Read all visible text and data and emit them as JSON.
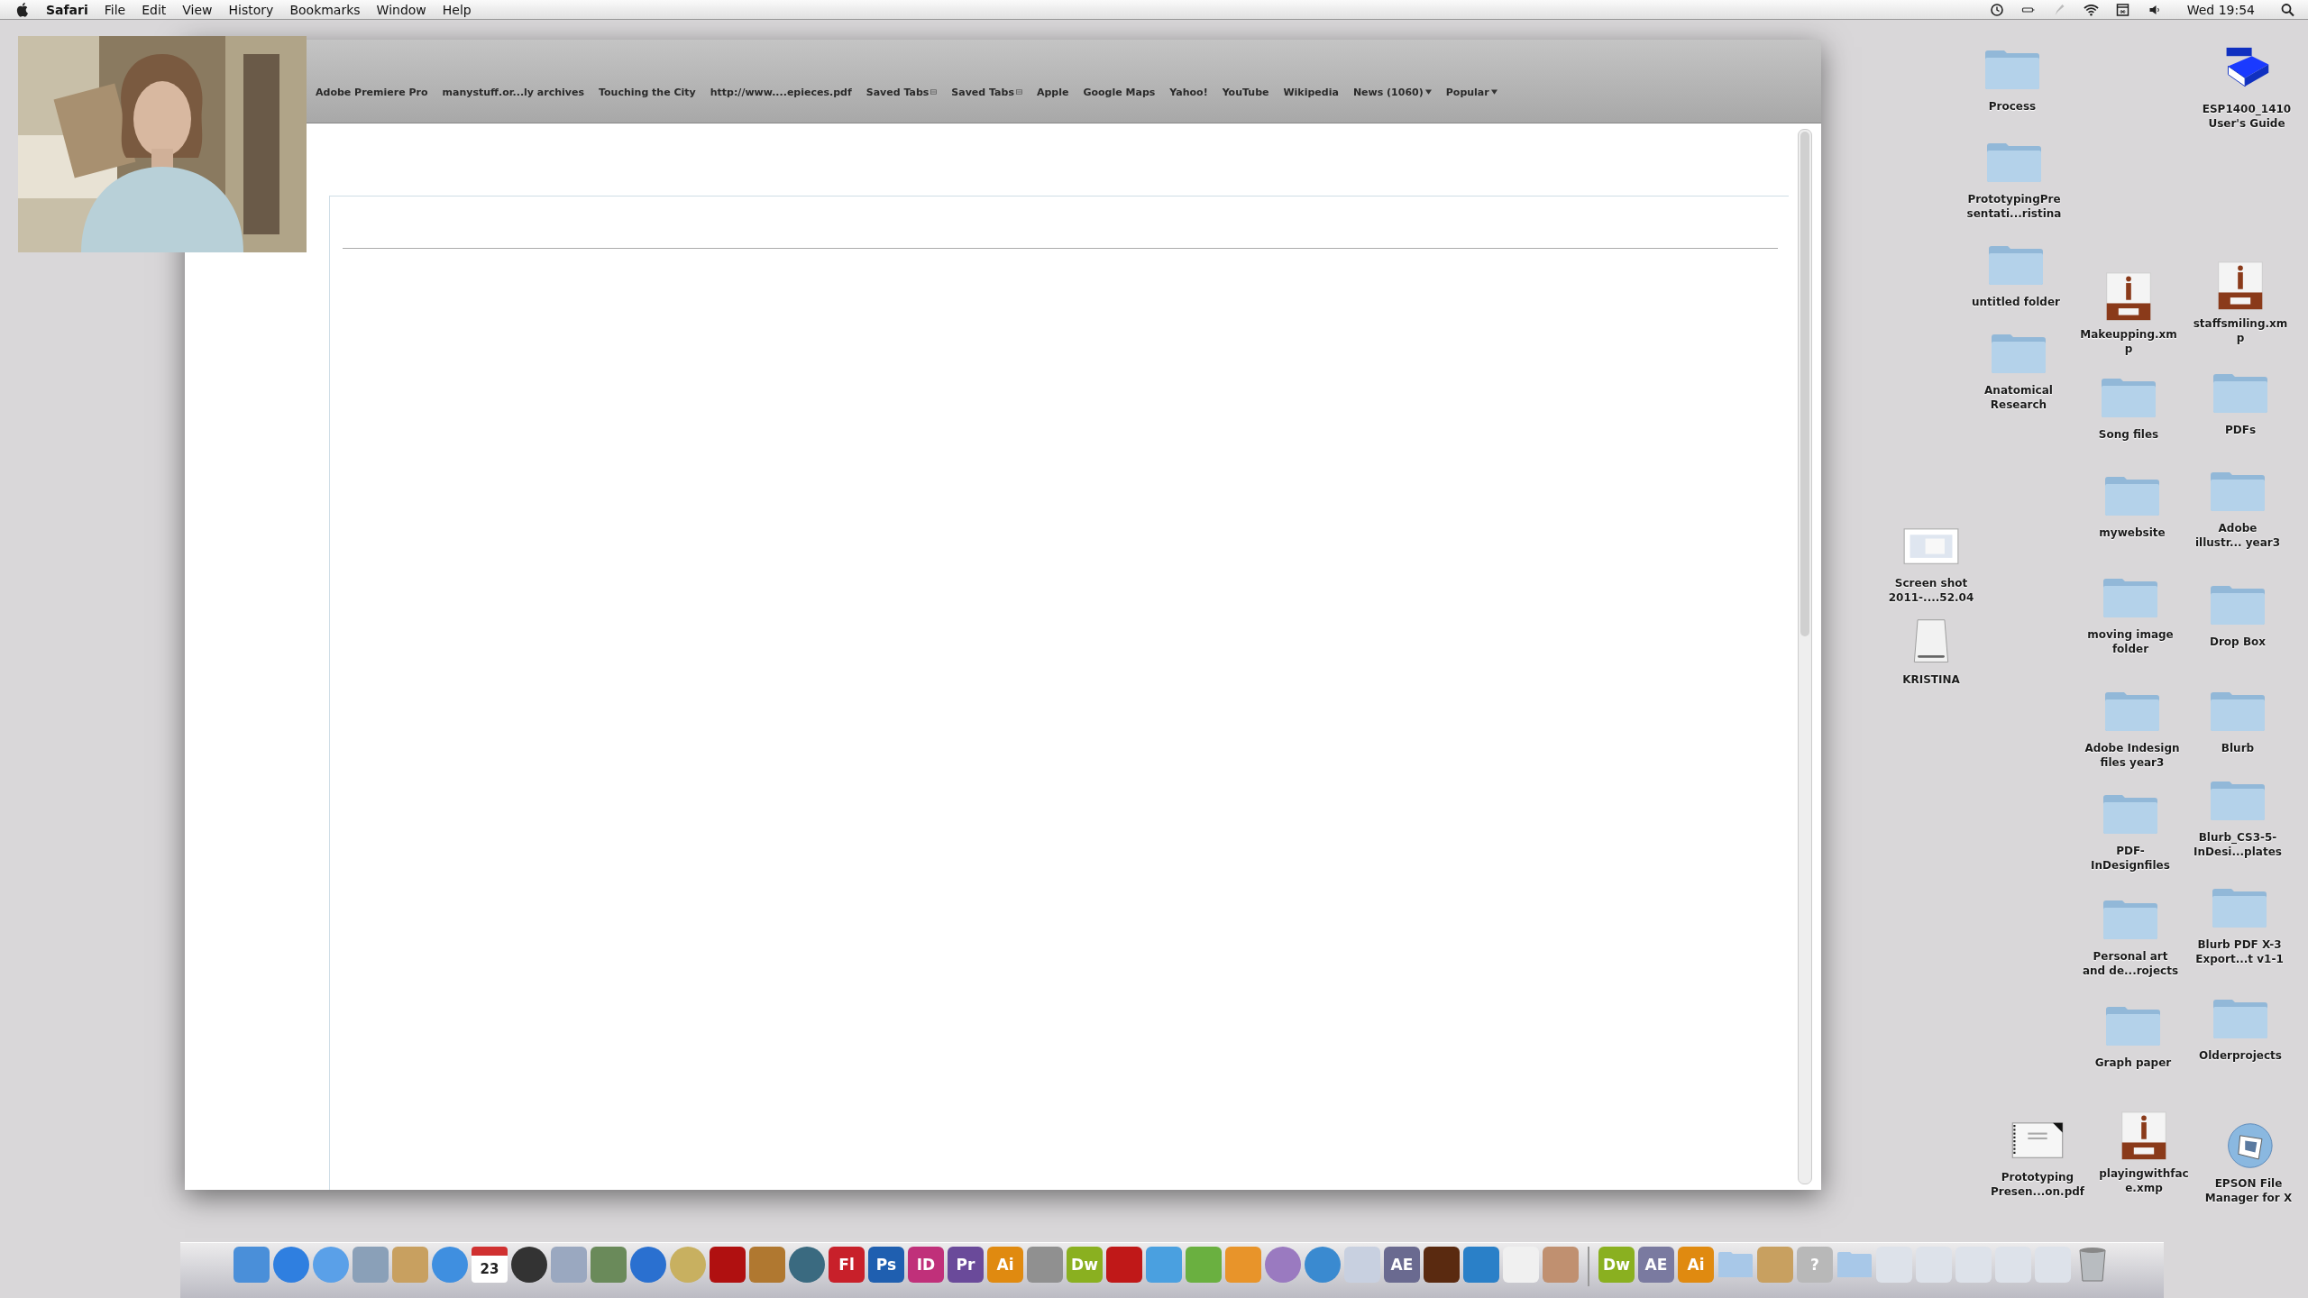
{
  "menu_bar": {
    "app": "Safari",
    "menus": [
      "File",
      "Edit",
      "View",
      "History",
      "Bookmarks",
      "Window",
      "Help"
    ],
    "clock": "Wed 19:54"
  },
  "browser": {
    "bookmarks": [
      {
        "label": "Adobe Premiere Pro",
        "kind": "link"
      },
      {
        "label": "manystuff.or...ly archives",
        "kind": "link"
      },
      {
        "label": "Touching the City",
        "kind": "link"
      },
      {
        "label": "http://www....epieces.pdf",
        "kind": "link"
      },
      {
        "label": "Saved Tabs",
        "kind": "tabs"
      },
      {
        "label": "Saved Tabs",
        "kind": "tabs"
      },
      {
        "label": "Apple",
        "kind": "link"
      },
      {
        "label": "Google Maps",
        "kind": "link"
      },
      {
        "label": "Yahoo!",
        "kind": "link"
      },
      {
        "label": "YouTube",
        "kind": "link"
      },
      {
        "label": "Wikipedia",
        "kind": "link"
      },
      {
        "label": "News (1060)",
        "kind": "menu"
      },
      {
        "label": "Popular",
        "kind": "menu"
      }
    ]
  },
  "desktop": [
    {
      "lines": [
        "Process"
      ],
      "kind": "folder"
    },
    {
      "lines": [
        "ESP1400_1410",
        "User's Guide"
      ],
      "kind": "book"
    },
    {
      "lines": [
        "PrototypingPre",
        "sentati...ristina"
      ],
      "kind": "folder"
    },
    {
      "lines": [
        "untitled folder"
      ],
      "kind": "folder"
    },
    {
      "lines": [
        "Makeupping.xm",
        "p"
      ],
      "kind": "xmp"
    },
    {
      "lines": [
        "staffsmiling.xm",
        "p"
      ],
      "kind": "xmp"
    },
    {
      "lines": [
        "Anatomical",
        "Research"
      ],
      "kind": "folder"
    },
    {
      "lines": [
        "Song files"
      ],
      "kind": "folder"
    },
    {
      "lines": [
        "PDFs"
      ],
      "kind": "folder"
    },
    {
      "lines": [
        "mywebsite"
      ],
      "kind": "folder"
    },
    {
      "lines": [
        "Adobe",
        "illustr... year3"
      ],
      "kind": "folder"
    },
    {
      "lines": [
        "Screen shot",
        "2011-....52.04"
      ],
      "kind": "screenshot"
    },
    {
      "lines": [
        "moving image",
        "folder"
      ],
      "kind": "folder"
    },
    {
      "lines": [
        "Drop Box"
      ],
      "kind": "folder"
    },
    {
      "lines": [
        "KRISTINA"
      ],
      "kind": "drive"
    },
    {
      "lines": [
        "Adobe Indesign",
        "files year3"
      ],
      "kind": "folder"
    },
    {
      "lines": [
        "Blurb"
      ],
      "kind": "folder"
    },
    {
      "lines": [
        "Blurb_CS3-5-",
        "InDesi...plates"
      ],
      "kind": "folder"
    },
    {
      "lines": [
        "PDF-",
        "InDesignfiles"
      ],
      "kind": "folder"
    },
    {
      "lines": [
        "Blurb PDF X-3",
        "Export...t v1-1"
      ],
      "kind": "folder"
    },
    {
      "lines": [
        "Personal art",
        "and de...rojects"
      ],
      "kind": "folder"
    },
    {
      "lines": [
        "Olderprojects"
      ],
      "kind": "folder"
    },
    {
      "lines": [
        "Graph paper"
      ],
      "kind": "folder"
    },
    {
      "lines": [
        "Prototyping",
        "Presen...on.pdf"
      ],
      "kind": "pdf"
    },
    {
      "lines": [
        "playingwithfac",
        "e.xmp"
      ],
      "kind": "xmp"
    },
    {
      "lines": [
        "EPSON File",
        "Manager for X"
      ],
      "kind": "app"
    }
  ],
  "dock": [
    {
      "kind": "square",
      "color": "#4a8fd9"
    },
    {
      "kind": "round",
      "color": "#2f7fe0"
    },
    {
      "kind": "round",
      "color": "#5aa0e8"
    },
    {
      "kind": "square",
      "color": "#8aa0b8"
    },
    {
      "kind": "square",
      "color": "#c8a060"
    },
    {
      "kind": "round",
      "color": "#3f8fe0"
    },
    {
      "kind": "calendar",
      "label": "23",
      "color": "#d03030"
    },
    {
      "kind": "round",
      "color": "#333333"
    },
    {
      "kind": "square",
      "color": "#9aa8c0"
    },
    {
      "kind": "square",
      "color": "#6a8a5a"
    },
    {
      "kind": "round",
      "color": "#2a70d0"
    },
    {
      "kind": "round",
      "color": "#c8b060"
    },
    {
      "kind": "square",
      "color": "#b01010"
    },
    {
      "kind": "square",
      "color": "#b07830"
    },
    {
      "kind": "round",
      "color": "#3a6a80"
    },
    {
      "kind": "letter",
      "label": "Fl",
      "color": "#c8202a"
    },
    {
      "kind": "letter",
      "label": "Ps",
      "color": "#1f5fb0"
    },
    {
      "kind": "letter",
      "label": "ID",
      "color": "#c0307a"
    },
    {
      "kind": "letter",
      "label": "Pr",
      "color": "#6a4a9a"
    },
    {
      "kind": "letter",
      "label": "Ai",
      "color": "#e08a10"
    },
    {
      "kind": "square",
      "color": "#909090"
    },
    {
      "kind": "letter",
      "label": "Dw",
      "color": "#8ab020"
    },
    {
      "kind": "square",
      "color": "#c01818"
    },
    {
      "kind": "square",
      "color": "#4aa0e0"
    },
    {
      "kind": "square",
      "color": "#6ab040"
    },
    {
      "kind": "square",
      "color": "#e8942a"
    },
    {
      "kind": "round",
      "color": "#9a7ac0"
    },
    {
      "kind": "round",
      "color": "#3a8ad0"
    },
    {
      "kind": "square",
      "color": "#c8d0e0"
    },
    {
      "kind": "letter",
      "label": "AE",
      "color": "#6a6a90"
    },
    {
      "kind": "square",
      "color": "#5a2a10"
    },
    {
      "kind": "square",
      "color": "#2a80c8"
    },
    {
      "kind": "square",
      "color": "#f0f0f0"
    },
    {
      "kind": "square",
      "color": "#c09070"
    },
    {
      "kind": "separator"
    },
    {
      "kind": "letter",
      "label": "Dw",
      "color": "#8ab020"
    },
    {
      "kind": "letter",
      "label": "AE",
      "color": "#7a7aa0"
    },
    {
      "kind": "letter",
      "label": "Ai",
      "color": "#e08a10"
    },
    {
      "kind": "folder",
      "color": "#a8c8e8"
    },
    {
      "kind": "square",
      "color": "#c8a060"
    },
    {
      "kind": "letter",
      "label": "?",
      "color": "#b8b8b8"
    },
    {
      "kind": "folder",
      "color": "#a8c8e8"
    },
    {
      "kind": "square",
      "color": "#dde2ea"
    },
    {
      "kind": "square",
      "color": "#dde2ea"
    },
    {
      "kind": "square",
      "color": "#dde2ea"
    },
    {
      "kind": "square",
      "color": "#dde2ea"
    },
    {
      "kind": "square",
      "color": "#dde2ea"
    },
    {
      "kind": "trash"
    }
  ]
}
